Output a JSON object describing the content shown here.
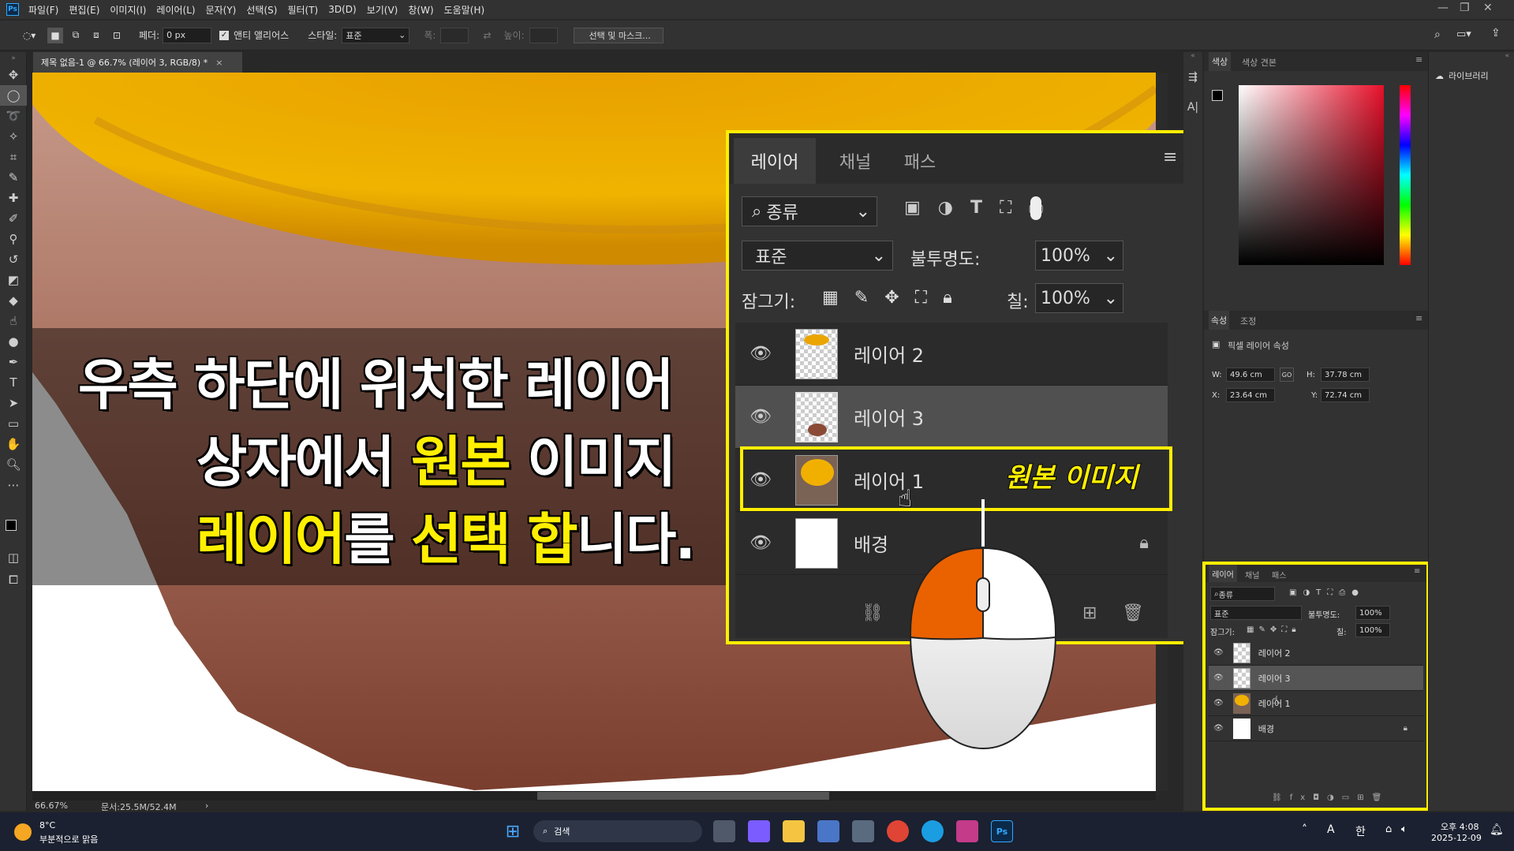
{
  "app": {
    "logo": "Ps"
  },
  "menu": [
    "파일(F)",
    "편집(E)",
    "이미지(I)",
    "레이어(L)",
    "문자(Y)",
    "선택(S)",
    "필터(T)",
    "3D(D)",
    "보기(V)",
    "창(W)",
    "도움말(H)"
  ],
  "options": {
    "feather_label": "페더:",
    "feather_value": "0 px",
    "antialias_label": "앤티 앨리어스",
    "style_label": "스타일:",
    "style_value": "표준",
    "width_label": "폭:",
    "height_label": "높이:",
    "select_mask_button": "선택 및 마스크..."
  },
  "document": {
    "tab_title": "제목 없음-1 @ 66.7% (레이어 3, RGB/8) *",
    "zoom": "66.67%",
    "doc_info": "문서:25.5M/52.4M"
  },
  "caption": {
    "line1": "우측 하단에 위치한 레이어",
    "line2_a": "상자에서 ",
    "line2_b": "원본",
    "line2_c": " 이미지",
    "line3_a": "레이어",
    "line3_b": "를 ",
    "line3_c": "선택",
    "line3_d": " ",
    "line3_e": "합",
    "line3_f": "니다."
  },
  "zoomed_layers_panel": {
    "tabs": [
      "레이어",
      "채널",
      "패스"
    ],
    "filter_label": "종류",
    "blend_mode": "표준",
    "opacity_label": "불투명도:",
    "opacity_value": "100%",
    "lock_label": "잠그기:",
    "fill_label": "칠:",
    "fill_value": "100%",
    "layers": [
      "레이어 2",
      "레이어 3",
      "레이어 1",
      "배경"
    ],
    "annotation": "원본 이미지"
  },
  "color_panel": {
    "tabs": [
      "색상",
      "색상 견본"
    ]
  },
  "properties_panel": {
    "tabs": [
      "속성",
      "조정"
    ],
    "title": "픽셀 레이어 속성",
    "w_label": "W:",
    "w_value": "49.6 cm",
    "h_label": "H:",
    "h_value": "37.78 cm",
    "x_label": "X:",
    "x_value": "23.64 cm",
    "y_label": "Y:",
    "y_value": "72.74 cm",
    "link_label": "GO"
  },
  "small_layers_panel": {
    "tabs": [
      "레이어",
      "채널",
      "패스"
    ],
    "filter_label": "종류",
    "blend_mode": "표준",
    "opacity_label": "불투명도:",
    "opacity_value": "100%",
    "lock_label": "잠그기:",
    "fill_label": "칠:",
    "fill_value": "100%",
    "layers": [
      "레이어 2",
      "레이어 3",
      "레이어 1",
      "배경"
    ]
  },
  "libraries_label": "라이브러리",
  "taskbar": {
    "weather_temp": "8°C",
    "weather_desc": "부분적으로 맑음",
    "search_placeholder": "검색",
    "time": "오후 4:08",
    "date": "2025-12-09",
    "ime_a": "A",
    "ime_b": "한"
  }
}
